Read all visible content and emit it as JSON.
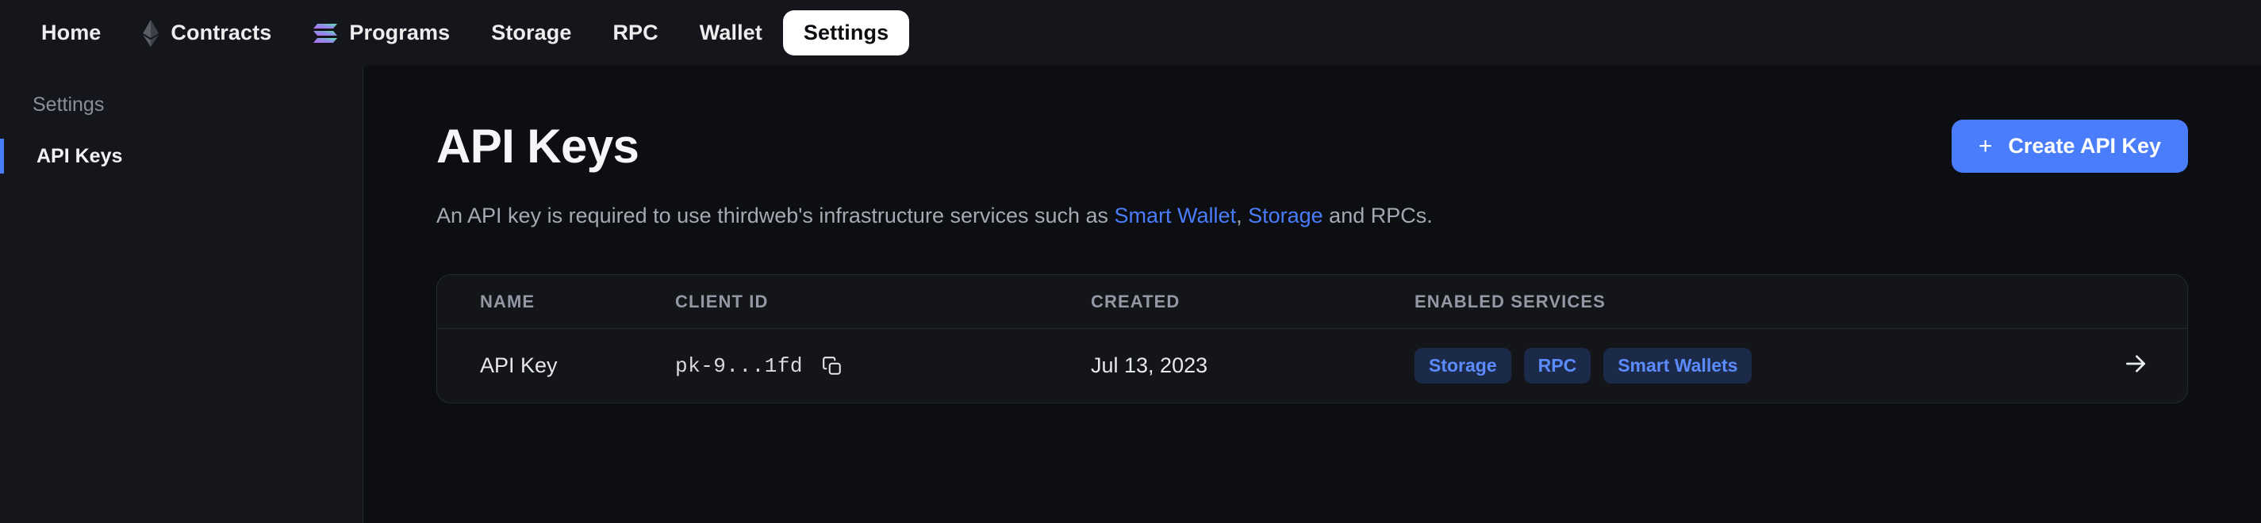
{
  "topnav": {
    "items": [
      {
        "label": "Home",
        "icon": null,
        "active": false
      },
      {
        "label": "Contracts",
        "icon": "ethereum-icon",
        "active": false
      },
      {
        "label": "Programs",
        "icon": "solana-icon",
        "active": false
      },
      {
        "label": "Storage",
        "icon": null,
        "active": false
      },
      {
        "label": "RPC",
        "icon": null,
        "active": false
      },
      {
        "label": "Wallet",
        "icon": null,
        "active": false
      },
      {
        "label": "Settings",
        "icon": null,
        "active": true
      }
    ]
  },
  "sidebar": {
    "title": "Settings",
    "items": [
      {
        "label": "API Keys",
        "selected": true
      }
    ]
  },
  "main": {
    "title": "API Keys",
    "description": {
      "part1": "An API key is required to use thirdweb's infrastructure services such as ",
      "link1": "Smart Wallet",
      "sep1": ", ",
      "link2": "Storage",
      "part2": " and RPCs."
    },
    "create_button": {
      "label": "Create API Key",
      "icon": "plus-icon"
    },
    "table": {
      "columns": [
        "NAME",
        "CLIENT ID",
        "CREATED",
        "ENABLED SERVICES"
      ],
      "rows": [
        {
          "name": "API Key",
          "client_id": "pk-9...1fd",
          "copy_icon": "copy-icon",
          "created": "Jul 13, 2023",
          "services": [
            "Storage",
            "RPC",
            "Smart Wallets"
          ],
          "arrow_icon": "arrow-right-icon"
        }
      ]
    }
  },
  "colors": {
    "accent": "#4a7dfc",
    "badge_bg": "#1c2a4a",
    "badge_text": "#5b8bfd",
    "nav_bg": "#14161b",
    "main_bg": "#0d0e12",
    "card_bg": "#131519",
    "border": "#25282f"
  }
}
